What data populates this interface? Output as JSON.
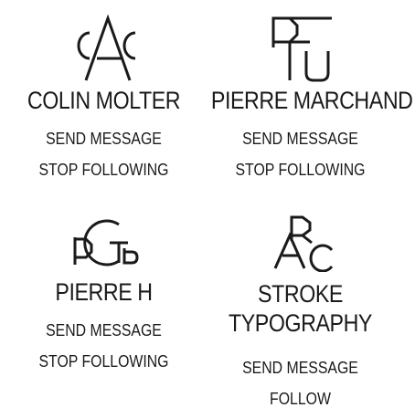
{
  "profiles": [
    {
      "logo_icon": "monogram-cac-icon",
      "name": "COLIN MOLTER",
      "primary_action": "SEND MESSAGE",
      "secondary_action": "STOP FOLLOWING"
    },
    {
      "logo_icon": "monogram-pfu-icon",
      "name": "PIERRE MARCHAND",
      "primary_action": "SEND MESSAGE",
      "secondary_action": "STOP FOLLOWING"
    },
    {
      "logo_icon": "monogram-pctb-icon",
      "name": "PIERRE H",
      "primary_action": "SEND MESSAGE",
      "secondary_action": "STOP FOLLOWING"
    },
    {
      "logo_icon": "monogram-rac-icon",
      "name_line1": "STROKE",
      "name_line2": "TYPOGRAPHY",
      "primary_action": "SEND MESSAGE",
      "secondary_action": "FOLLOW"
    }
  ],
  "colors": {
    "text": "#1a1a1a",
    "background": "#ffffff"
  }
}
